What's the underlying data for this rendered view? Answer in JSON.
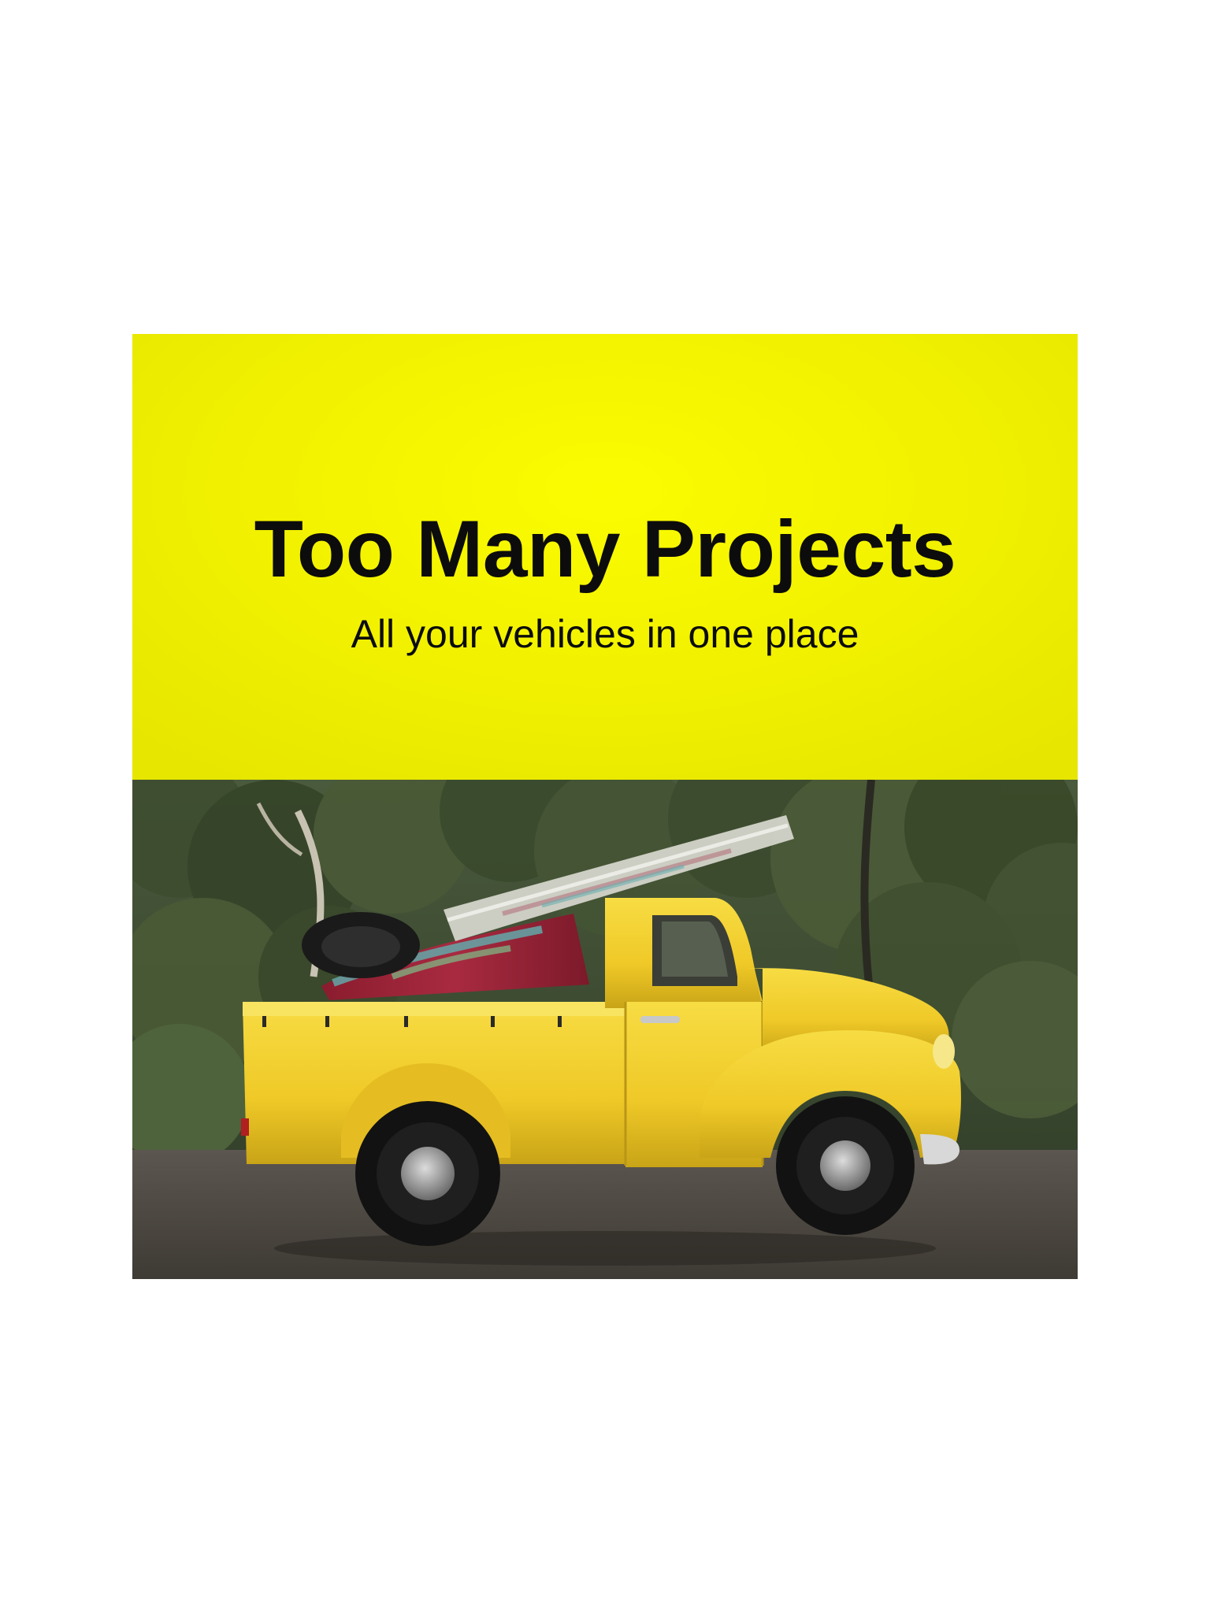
{
  "banner": {
    "title": "Too Many Projects",
    "subtitle": "All your vehicles in one place",
    "background_color": "#f3f300",
    "text_color": "#0c0c0c"
  },
  "photo": {
    "subject": "yellow-pickup-truck-photo",
    "truck_color": "#f2cf2b",
    "cargo_color": "#9c2035"
  }
}
